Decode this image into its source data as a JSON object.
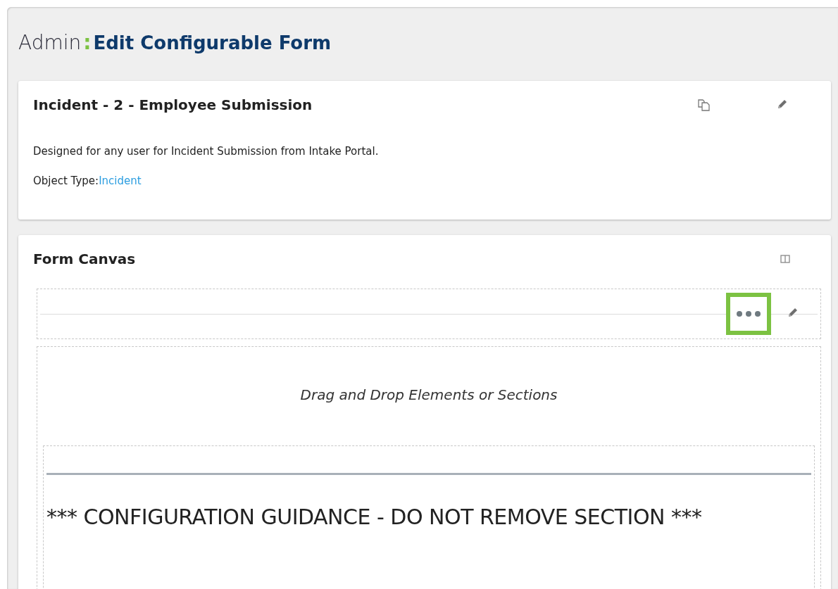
{
  "header": {
    "prefix": "Admin",
    "separator": ":",
    "title": "Edit Configurable Form"
  },
  "form_card": {
    "title": "Incident - 2 - Employee Submission",
    "description": "Designed for any user for Incident Submission from Intake Portal.",
    "object_type_label": "Object Type:",
    "object_type_link": "Incident"
  },
  "canvas_card": {
    "title": "Form Canvas",
    "section_menu": {
      "highlighted": true
    },
    "drop_hint": "Drag and Drop Elements or Sections",
    "section_heading": "*** CONFIGURATION GUIDANCE - DO NOT REMOVE SECTION ***"
  }
}
